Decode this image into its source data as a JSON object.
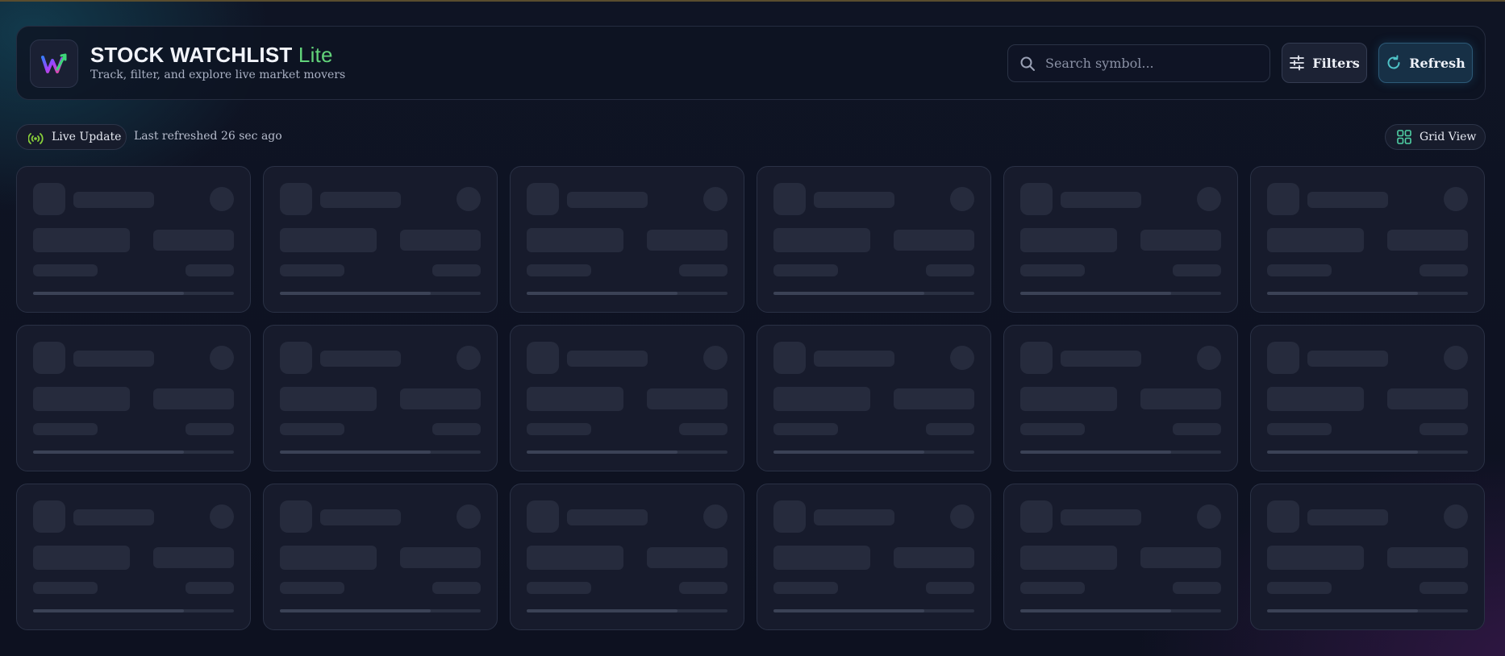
{
  "app": {
    "title": "STOCK WATCHLIST",
    "title_suffix": "Lite",
    "subtitle": "Track, filter, and explore live market movers",
    "logo_icon": "watchlist-logo-icon"
  },
  "search": {
    "placeholder": "Search symbol...",
    "value": ""
  },
  "toolbar": {
    "filters_label": "Filters",
    "refresh_label": "Refresh"
  },
  "status": {
    "live_label": "Live Update",
    "last_refreshed": "Last refreshed 26 sec ago"
  },
  "view": {
    "label": "Grid View"
  },
  "cards": {
    "state": "loading",
    "count": 18
  },
  "colors": {
    "accent_green": "#62d37a",
    "accent_cyan": "#4fc3c8",
    "background": "#0f1424"
  }
}
